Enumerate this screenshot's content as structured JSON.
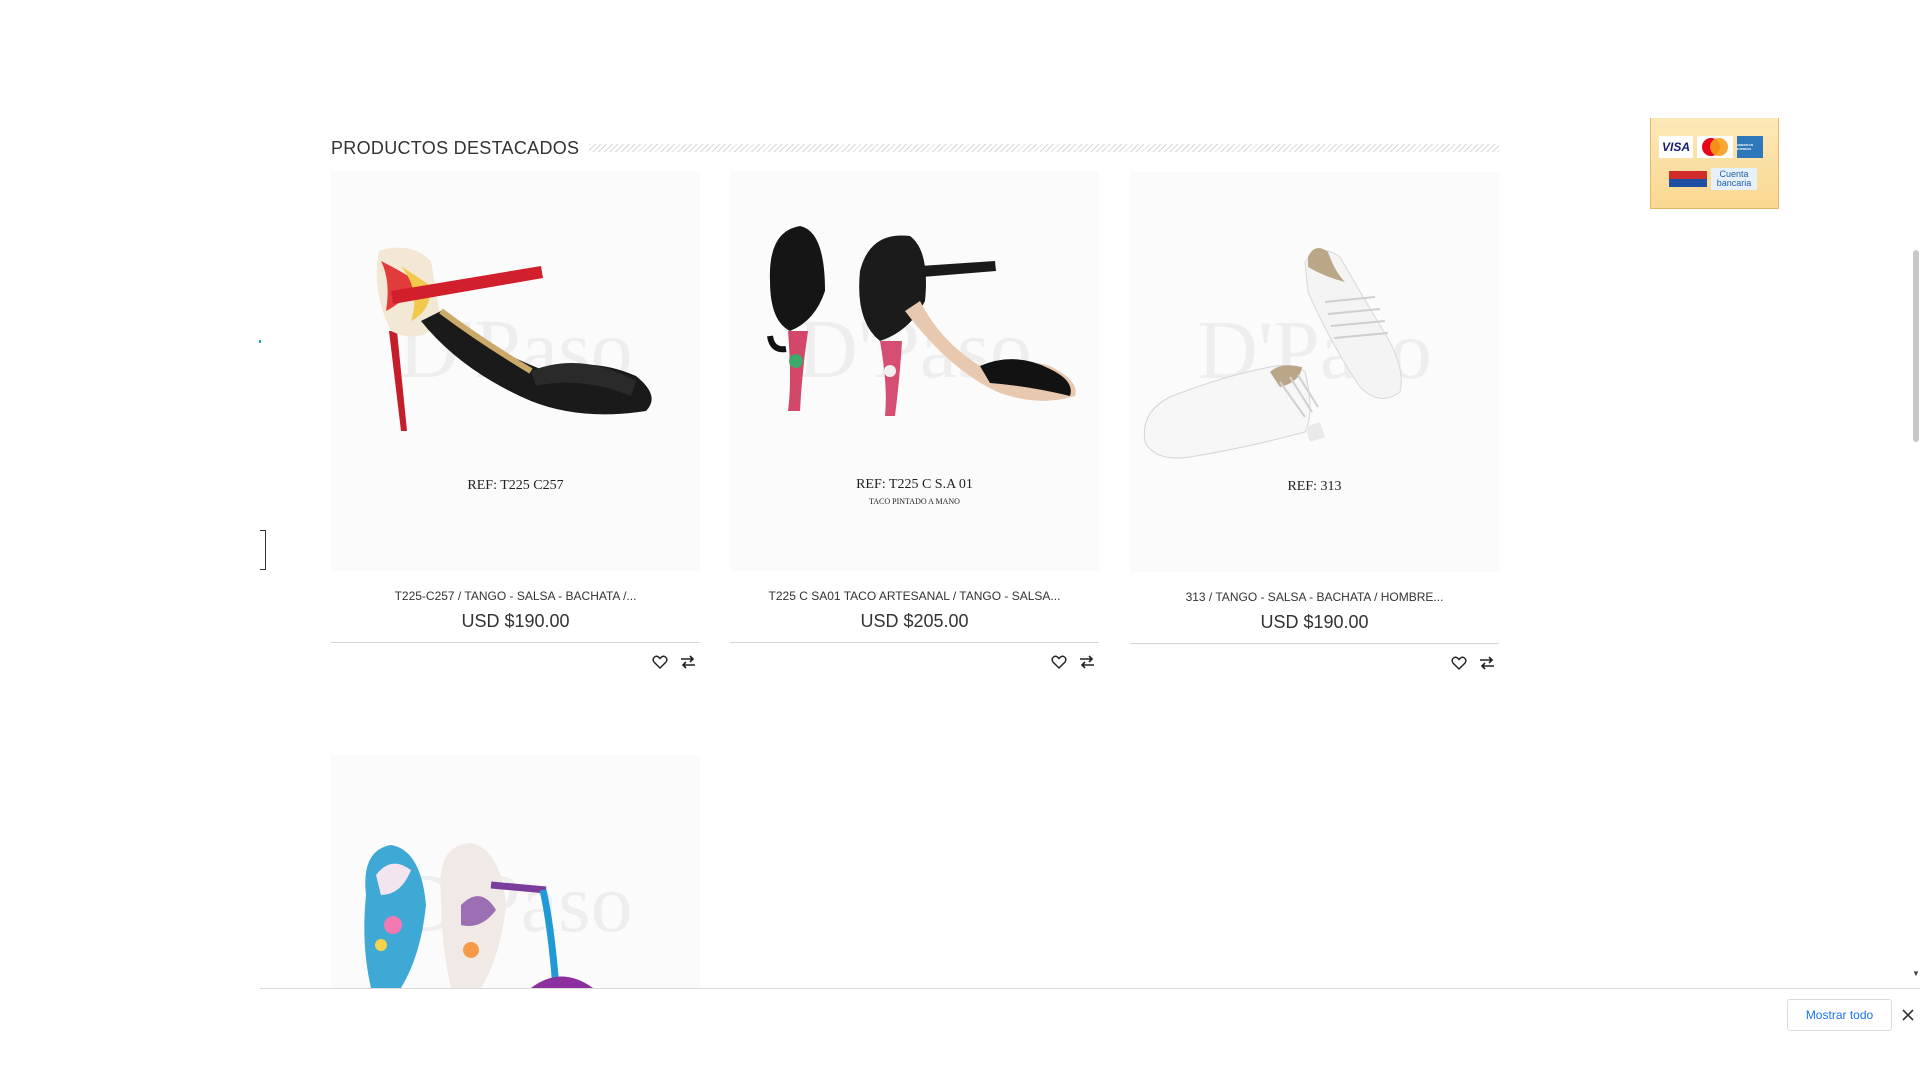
{
  "section": {
    "title": "PRODUCTOS DESTACADOS"
  },
  "products": [
    {
      "ref": "REF: T225 C257",
      "ref_sub": "",
      "name": "T225-C257 / TANGO - SALSA - BACHATA /...",
      "price": "USD $190.00"
    },
    {
      "ref": "REF: T225 C S.A 01",
      "ref_sub": "TACO PINTADO A MANO",
      "name": "T225 C SA01 TACO ARTESANAL / TANGO - SALSA...",
      "price": "USD $205.00"
    },
    {
      "ref": "REF: 313",
      "ref_sub": "",
      "name": "313 / TANGO - SALSA - BACHATA / HOMBRE...",
      "price": "USD $190.00"
    },
    {
      "ref": "",
      "ref_sub": "",
      "name": "",
      "price": ""
    }
  ],
  "watermark": "D'Paso",
  "payment": {
    "visa": "VISA",
    "amex": "AMERICAN EXPRESS",
    "bank": "Cuenta bancaria"
  },
  "actions": {
    "wishlist_icon": "heart-icon",
    "compare_icon": "swap-arrows-icon"
  },
  "download_bar": {
    "show_all": "Mostrar todo",
    "close_icon": "close-icon"
  },
  "colors": {
    "text": "#333333",
    "link_blue": "#1a73e8",
    "badge_bg": "#f9d890"
  }
}
